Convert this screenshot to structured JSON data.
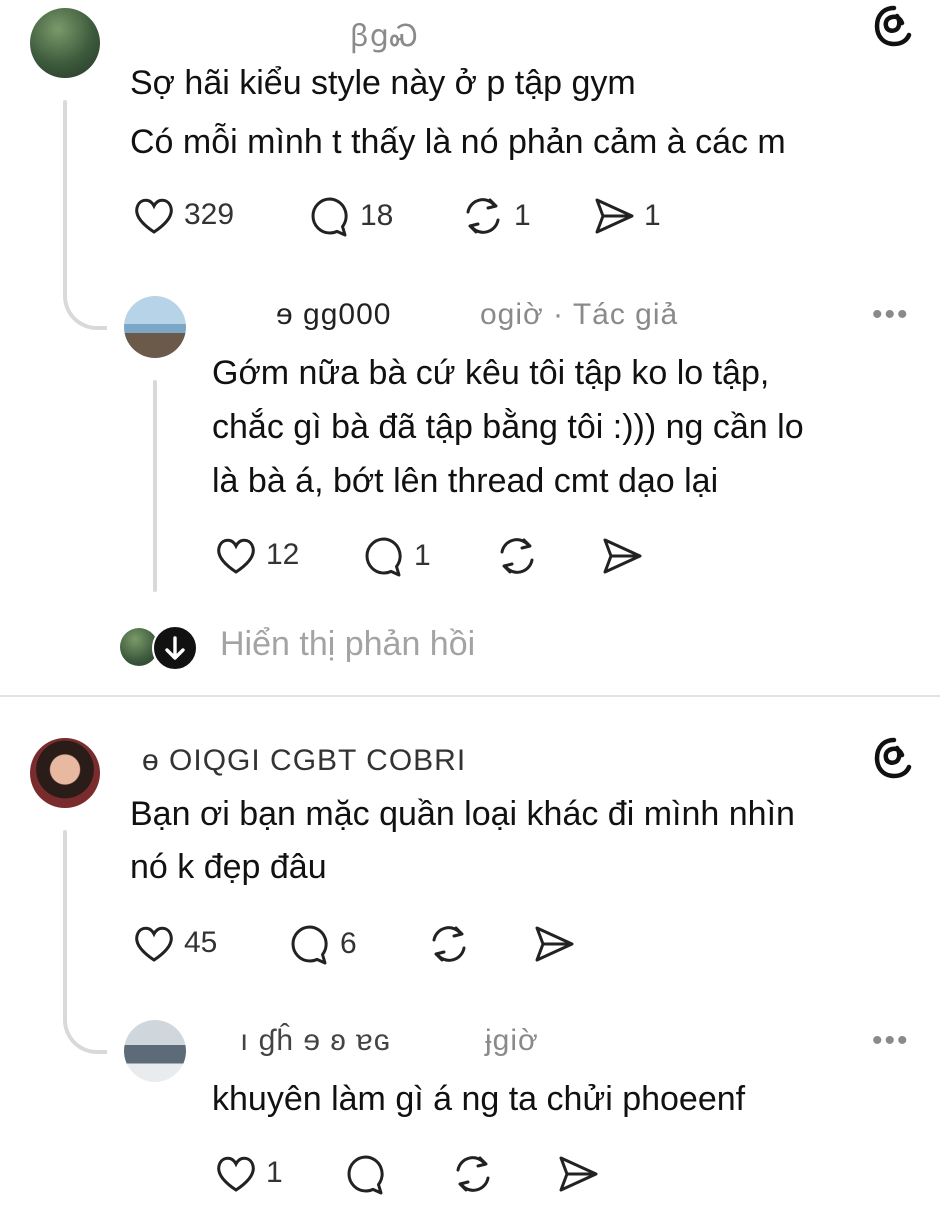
{
  "comments": [
    {
      "username": "ꞵցᏍ",
      "lines": [
        "Sợ hãi kiểu style này ở p tập gym",
        "Có mỗi mình t thấy là nó phản cảm à các m"
      ],
      "likes": "329",
      "replies": "18",
      "reposts": "1",
      "shares": "1",
      "reply": {
        "username": "ɘ ɡɡ000",
        "meta": "ogiờ · Tác giả",
        "lines": [
          "Gớm nữa bà cứ kêu tôi tập ko lo tập,",
          "chắc gì bà đã tập bằng tôi :))) ng cần lo",
          "là bà á, bớt lên thread cmt dạo lại"
        ],
        "likes": "12",
        "replies": "1"
      },
      "show_replies": "Hiển thị phản hồi"
    },
    {
      "username": "ɵ  OIQGI CGBT COBRI",
      "lines": [
        "Bạn ơi bạn mặc quần loại khác đi mình nhìn",
        "nó k đẹp đâu"
      ],
      "likes": "45",
      "replies": "6",
      "reply": {
        "username": "ı ɠĥ ɘ ʚ ɐɢ",
        "meta": "ɉgiờ",
        "lines": [
          "khuyên làm gì á ng ta chửi phoeenf"
        ],
        "likes": "1"
      }
    }
  ],
  "more_label": "•••",
  "colors": {
    "muted": "#8a8a8a",
    "line": "#d9d9d9",
    "text": "#111111"
  }
}
